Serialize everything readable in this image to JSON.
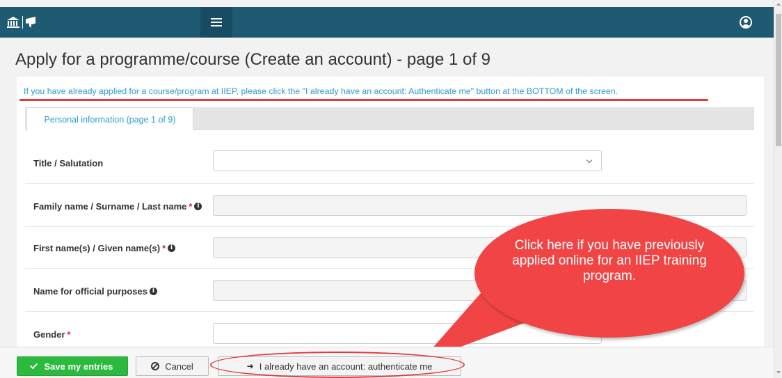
{
  "header": {
    "logo_icons": [
      "unesco-temple-icon",
      "iiep-book-icon"
    ],
    "menu_icon": "hamburger-menu-icon",
    "user_icon": "user-circle-icon"
  },
  "page": {
    "title": "Apply for a programme/course (Create an account) - page 1 of 9",
    "notice": "If you have already applied for a course/program at IIEP, please click the \"I already have an account: Authenticate me\" button at the BOTTOM of the screen."
  },
  "tabs": [
    {
      "label": "Personal information (page 1 of 9)",
      "active": true
    }
  ],
  "form": {
    "fields": [
      {
        "label": "Title / Salutation",
        "required": false,
        "info": false,
        "type": "select",
        "value": ""
      },
      {
        "label": "Family name / Surname / Last name",
        "required": true,
        "info": true,
        "type": "text",
        "value": ""
      },
      {
        "label": "First name(s) / Given name(s)",
        "required": true,
        "info": true,
        "type": "text",
        "value": ""
      },
      {
        "label": "Name for official purposes",
        "required": false,
        "info": true,
        "type": "text",
        "value": ""
      },
      {
        "label": "Gender",
        "required": true,
        "info": false,
        "type": "select",
        "value": ""
      }
    ],
    "required_mark": "*",
    "info_mark": "i"
  },
  "callout": {
    "text": "Click here if you have previously applied online for an IIEP training program."
  },
  "toolbar": {
    "save_label": "Save my entries",
    "cancel_label": "Cancel",
    "auth_label": "I already have an account: authenticate me",
    "auth_icon": "sign-in-icon",
    "auth_icon_glyph": "➜"
  },
  "colors": {
    "header_bg": "#1f5a73",
    "link_blue": "#2e9bd6",
    "save_green": "#2bba3e",
    "annotation_red": "#f14545",
    "required_red": "#d9263c"
  }
}
